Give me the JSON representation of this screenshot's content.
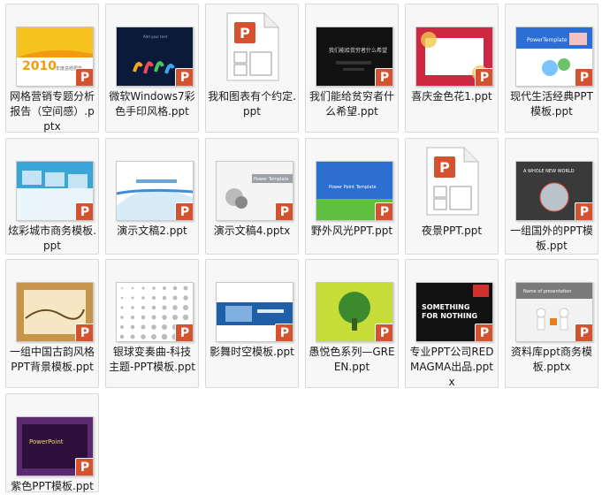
{
  "window": {
    "view": "large-icons"
  },
  "files": [
    {
      "name": "网格营销专题分析报告（空间感）.pptx",
      "thumb": "yellow-2010",
      "thumb_text": [
        "2010",
        "年度总结报告"
      ],
      "icon": "powerpoint-icon"
    },
    {
      "name": "微软Windows7彩色手印风格.ppt",
      "thumb": "dark-handprint",
      "thumb_text": [
        "Add your text"
      ],
      "icon": "powerpoint-icon"
    },
    {
      "name": "我和图表有个约定.ppt",
      "thumb": "generic-file",
      "thumb_text": [],
      "icon": "powerpoint-file-icon"
    },
    {
      "name": "我们能给贫穷者什么希望.ppt",
      "thumb": "dark-hope",
      "thumb_text": [
        "我们能给贫穷者什么希望"
      ],
      "icon": "powerpoint-icon"
    },
    {
      "name": "喜庆金色花1.ppt",
      "thumb": "red-gold-flower",
      "thumb_text": [],
      "icon": "powerpoint-icon"
    },
    {
      "name": "现代生活经典PPT模板.ppt",
      "thumb": "blue-modern",
      "thumb_text": [
        "PowerTemplate"
      ],
      "icon": "powerpoint-icon"
    },
    {
      "name": "炫彩城市商务模板.ppt",
      "thumb": "city-business",
      "thumb_text": [],
      "icon": "powerpoint-icon"
    },
    {
      "name": "演示文稿2.ppt",
      "thumb": "blue-wave",
      "thumb_text": [],
      "icon": "powerpoint-icon"
    },
    {
      "name": "演示文稿4.pptx",
      "thumb": "power-template-grey",
      "thumb_text": [
        "Power Template"
      ],
      "icon": "powerpoint-icon"
    },
    {
      "name": "野外风光PPT.ppt",
      "thumb": "blue-field",
      "thumb_text": [
        "Power Point Template"
      ],
      "icon": "powerpoint-icon"
    },
    {
      "name": "夜景PPT.ppt",
      "thumb": "generic-file",
      "thumb_text": [],
      "icon": "powerpoint-file-icon"
    },
    {
      "name": "一组国外的PPT模板.ppt",
      "thumb": "whole-new-world",
      "thumb_text": [
        "A WHOLE NEW WORLD"
      ],
      "icon": "powerpoint-icon"
    },
    {
      "name": "一组中国古韵风格PPT背景模板.ppt",
      "thumb": "chinese-scroll",
      "thumb_text": [],
      "icon": "powerpoint-icon"
    },
    {
      "name": "银球变奏曲-科技主题-PPT模板.ppt",
      "thumb": "silver-dots",
      "thumb_text": [],
      "icon": "powerpoint-icon"
    },
    {
      "name": "影舞时空模板.ppt",
      "thumb": "blue-banner",
      "thumb_text": [],
      "icon": "powerpoint-icon"
    },
    {
      "name": "愚悦色系列—GREEN.ppt",
      "thumb": "green-tree",
      "thumb_text": [],
      "icon": "powerpoint-icon"
    },
    {
      "name": "专业PPT公司REDMAGMA出品.pptx",
      "thumb": "something-nothing",
      "thumb_text": [
        "SOMETHING",
        "FOR NOTHING"
      ],
      "icon": "powerpoint-icon"
    },
    {
      "name": "资料库ppt商务模板.pptx",
      "thumb": "figures-presentation",
      "thumb_text": [
        "Name of presentation"
      ],
      "icon": "powerpoint-icon"
    },
    {
      "name": "紫色PPT模板.ppt",
      "thumb": "purple-powerpoint",
      "thumb_text": [
        "PowerPoint"
      ],
      "icon": "powerpoint-icon"
    }
  ],
  "colors": {
    "ppt_badge": "#d35230",
    "tile_border": "#d9d9d9"
  }
}
